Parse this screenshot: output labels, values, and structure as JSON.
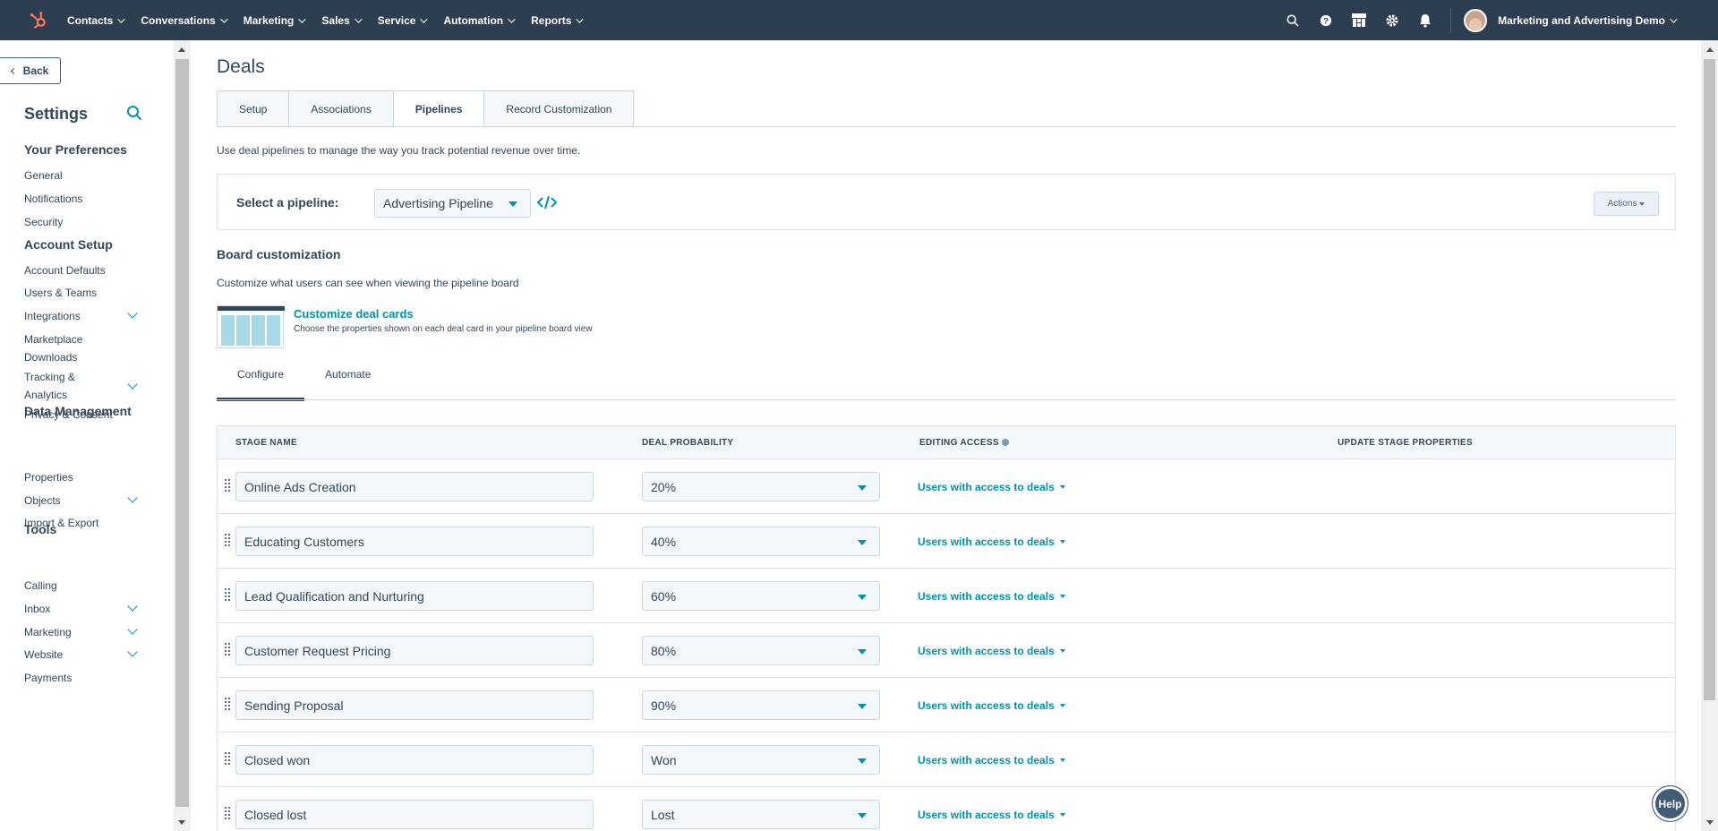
{
  "topnav": {
    "logo_icon": "hubspot-sprocket-icon",
    "items": [
      {
        "label": "Contacts"
      },
      {
        "label": "Conversations"
      },
      {
        "label": "Marketing"
      },
      {
        "label": "Sales"
      },
      {
        "label": "Service"
      },
      {
        "label": "Automation"
      },
      {
        "label": "Reports"
      }
    ],
    "icons": [
      "search-icon",
      "help-circle-icon",
      "marketplace-icon",
      "gear-icon",
      "bell-icon"
    ],
    "account_name": "Marketing and Advertising Demo"
  },
  "sidebar": {
    "back_label": "Back",
    "title": "Settings",
    "sections": [
      {
        "title": "Your Preferences",
        "items": [
          {
            "label": "General"
          },
          {
            "label": "Notifications"
          },
          {
            "label": "Security"
          }
        ]
      },
      {
        "title": "Account Setup",
        "items": [
          {
            "label": "Account Defaults"
          },
          {
            "label": "Users & Teams"
          },
          {
            "label": "Integrations",
            "expandable": true
          },
          {
            "label": "Marketplace Downloads"
          },
          {
            "label": "Tracking & Analytics",
            "expandable": true
          },
          {
            "label": "Privacy & Consent"
          }
        ]
      },
      {
        "title": "Data Management",
        "items": [
          {
            "label": "Properties"
          },
          {
            "label": "Objects",
            "expandable": true
          },
          {
            "label": "Import & Export"
          }
        ]
      },
      {
        "title": "Tools",
        "items": [
          {
            "label": "Calling"
          },
          {
            "label": "Inbox",
            "expandable": true
          },
          {
            "label": "Marketing",
            "expandable": true
          },
          {
            "label": "Website",
            "expandable": true
          },
          {
            "label": "Payments"
          }
        ]
      }
    ]
  },
  "main": {
    "title": "Deals",
    "tabs": [
      {
        "label": "Setup"
      },
      {
        "label": "Associations"
      },
      {
        "label": "Pipelines",
        "active": true
      },
      {
        "label": "Record Customization"
      }
    ],
    "intro": "Use deal pipelines to manage the way you track potential revenue over time.",
    "pipeline": {
      "label": "Select a pipeline:",
      "selected": "Advertising Pipeline",
      "actions_label": "Actions"
    },
    "board": {
      "title": "Board customization",
      "desc": "Customize what users can see when viewing the pipeline board",
      "link": "Customize deal cards",
      "link_desc": "Choose the properties shown on each deal card in your pipeline board view"
    },
    "subtabs": [
      {
        "label": "Configure",
        "active": true
      },
      {
        "label": "Automate"
      }
    ],
    "table": {
      "headers": {
        "stage": "STAGE NAME",
        "probability": "DEAL PROBABILITY",
        "access": "EDITING ACCESS",
        "update": "UPDATE STAGE PROPERTIES"
      },
      "rows": [
        {
          "stage": "Online Ads Creation",
          "probability": "20%",
          "access": "Users with access to deals"
        },
        {
          "stage": "Educating Customers",
          "probability": "40%",
          "access": "Users with access to deals"
        },
        {
          "stage": "Lead Qualification and Nurturing",
          "probability": "60%",
          "access": "Users with access to deals"
        },
        {
          "stage": "Customer Request Pricing",
          "probability": "80%",
          "access": "Users with access to deals"
        },
        {
          "stage": "Sending Proposal",
          "probability": "90%",
          "access": "Users with access to deals"
        },
        {
          "stage": "Closed won",
          "probability": "Won",
          "access": "Users with access to deals"
        },
        {
          "stage": "Closed lost",
          "probability": "Lost",
          "access": "Users with access to deals"
        }
      ]
    }
  },
  "help_label": "Help",
  "colors": {
    "nav_bg": "#2d3e50",
    "accent": "#0091ae",
    "logo": "#ff7a59",
    "text": "#33475b"
  }
}
